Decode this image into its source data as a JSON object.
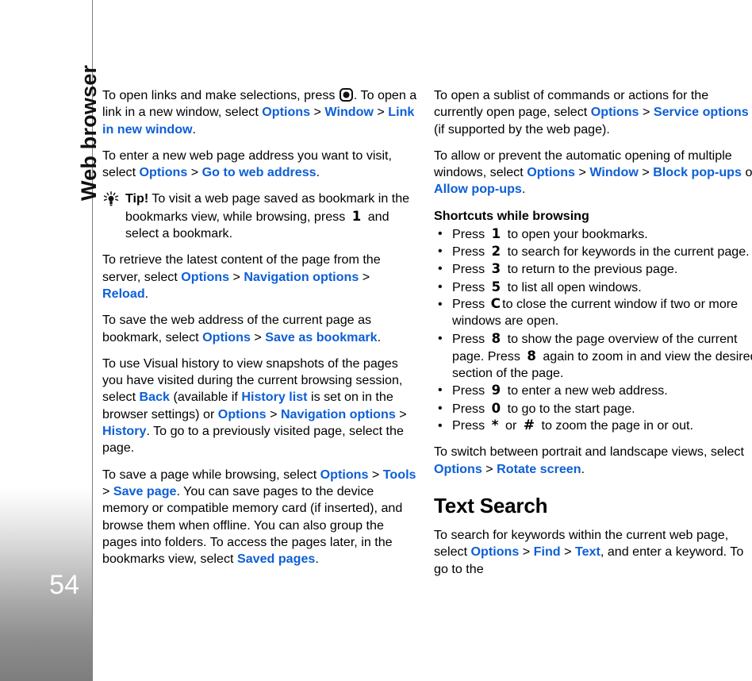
{
  "sidebar": {
    "chapter_title": "Web browser",
    "page_number": "54",
    "gradient_top_color": "#ffffff",
    "gradient_bottom_color": "#7d7d7d"
  },
  "theme": {
    "link_color": "#0d5fd6",
    "text_color": "#000000",
    "background": "#ffffff"
  },
  "left_column": {
    "p1": {
      "a": "To open links and make selections, press",
      "b": ". To open a link in a new window, select ",
      "opt": "Options",
      "gt1": " > ",
      "window": "Window",
      "gt2": " > ",
      "linkinnew": "Link in new window",
      "end": "."
    },
    "p2": {
      "a": "To enter a new web page address you want to visit, select ",
      "opt": "Options",
      "gt1": " > ",
      "goto": "Go to web address",
      "end": "."
    },
    "tip": {
      "label": "Tip!",
      "a": " To visit a web page saved as bookmark in the bookmarks view, while browsing, press",
      "key": "1",
      "b": "and select a bookmark."
    },
    "p3": {
      "a": "To retrieve the latest content of the page from the server, select ",
      "opt": "Options",
      "gt1": " > ",
      "nav": "Navigation options",
      "gt2": " > ",
      "reload": "Reload",
      "end": "."
    },
    "p4": {
      "a": "To save the web address of the current page as bookmark, select ",
      "opt": "Options",
      "gt1": " > ",
      "saveas": "Save as bookmark",
      "end": "."
    },
    "p5": {
      "a": "To use Visual history to view snapshots of the pages you have visited during the current browsing session, select ",
      "back": "Back",
      "b": " (available if ",
      "hist_list": "History list",
      "c": " is set on in the browser settings) or ",
      "opt": "Options",
      "gt1": " > ",
      "nav": "Navigation options",
      "gt2": " > ",
      "history": "History",
      "d": ". To go to a previously visited page, select the page."
    },
    "p6": {
      "a": "To save a page while browsing, select ",
      "opt": "Options",
      "gt1": " > ",
      "tools": "Tools",
      "gt2": " > ",
      "savepage": "Save page",
      "b": ". You can save pages to the device memory or compatible memory card (if inserted), and browse them when offline. You can also group the pages into folders. To access the pages later, in the bookmarks view, select ",
      "savedpages": "Saved pages",
      "end": "."
    }
  },
  "right_column": {
    "p1": {
      "a": "To open a sublist of commands or actions for the currently open page, select ",
      "opt": "Options",
      "gt1": " > ",
      "service": "Service options",
      "b": " (if supported by the web page)."
    },
    "p2": {
      "a": "To allow or prevent the automatic opening of multiple windows, select ",
      "opt": "Options",
      "gt1": " > ",
      "window": "Window",
      "gt2": " > ",
      "block": "Block pop-ups",
      "b": " or ",
      "allow": "Allow pop-ups",
      "end": "."
    },
    "shortcuts_heading": "Shortcuts while browsing",
    "shortcuts": [
      {
        "press": "Press",
        "key": "1",
        "key_type": "digit",
        "text": "to open your bookmarks."
      },
      {
        "press": "Press",
        "key": "2",
        "key_type": "digit",
        "text": "to search for keywords in the current page."
      },
      {
        "press": "Press",
        "key": "3",
        "key_type": "digit",
        "text": "to return to the previous page."
      },
      {
        "press": "Press",
        "key": "5",
        "key_type": "digit",
        "text": "to list all open windows."
      },
      {
        "press": "Press",
        "key": "C",
        "key_type": "clear",
        "text": "to close the current window if two or more windows are open."
      },
      {
        "press": "Press",
        "key": "8",
        "key_type": "digit",
        "text": "to show the page overview of the current page. Press",
        "key2": "8",
        "text2": "again to zoom in and view the desired section of the page."
      },
      {
        "press": "Press",
        "key": "9",
        "key_type": "digit",
        "text": "to enter a new web address."
      },
      {
        "press": "Press",
        "key": "0",
        "key_type": "digit",
        "text": "to go to the start page."
      },
      {
        "press": "Press",
        "key": "*",
        "key_type": "symbol",
        "text": "or",
        "key2": "#",
        "text2": "to zoom the page in or out."
      }
    ],
    "p3": {
      "a": "To switch between portrait and landscape views, select ",
      "opt": "Options",
      "gt1": " > ",
      "rotate": "Rotate screen",
      "end": "."
    },
    "section_heading": "Text Search",
    "p4": {
      "a": "To search for keywords within the current web page, select ",
      "opt": "Options",
      "gt1": " > ",
      "find": "Find",
      "gt2": " > ",
      "text": "Text",
      "b": ", and enter a keyword. To go to the"
    }
  },
  "icons": {
    "scroll_key": "scroll-select-key-icon",
    "tip_bulb": "lightbulb-icon",
    "bullet": "•"
  }
}
